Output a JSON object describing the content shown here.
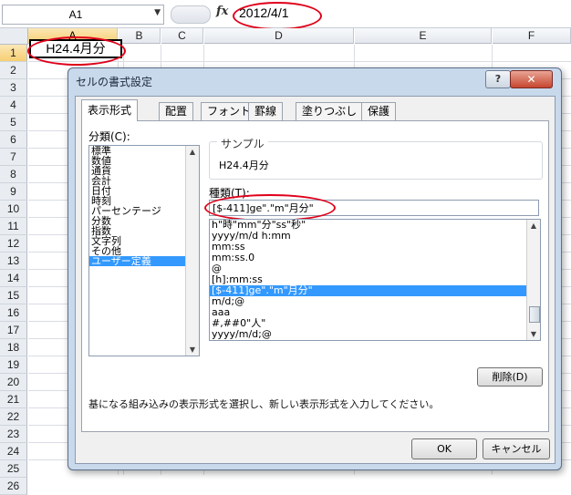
{
  "formula_bar": {
    "name_box": "A1",
    "fx_label": "fx",
    "formula": "2012/4/1"
  },
  "sheet": {
    "columns": [
      "A",
      "B",
      "C",
      "D",
      "E",
      "F"
    ],
    "rows": [
      "1",
      "2",
      "3",
      "4",
      "5",
      "6",
      "7",
      "8",
      "9",
      "10",
      "11",
      "12",
      "13",
      "14",
      "15",
      "16",
      "17",
      "18",
      "19",
      "20",
      "21",
      "22",
      "23",
      "24",
      "25",
      "26"
    ],
    "active_cell_value": "H24.4月分"
  },
  "dialog": {
    "title": "セルの書式設定",
    "help_label": "?",
    "close_label": "✕",
    "tabs": [
      {
        "label": "表示形式",
        "active": true
      },
      {
        "label": "配置"
      },
      {
        "label": "フォント"
      },
      {
        "label": "罫線"
      },
      {
        "label": "塗りつぶし"
      },
      {
        "label": "保護"
      }
    ],
    "category_label": "分類(C):",
    "categories": [
      "標準",
      "数値",
      "通貨",
      "会計",
      "日付",
      "時刻",
      "パーセンテージ",
      "分数",
      "指数",
      "文字列",
      "その他",
      "ユーザー定義"
    ],
    "selected_category": "ユーザー定義",
    "sample_label": "サンプル",
    "sample_value": "H24.4月分",
    "type_label": "種類(T):",
    "type_value": "[$-411]ge\".\"m\"月分\"",
    "format_list": [
      "h\"時\"mm\"分\"ss\"秒\"",
      "yyyy/m/d h:mm",
      "mm:ss",
      "mm:ss.0",
      "@",
      "[h]:mm:ss",
      "[$-411]ge\".\"m\"月分\"",
      "m/d;@",
      "aaa",
      "#,##0\"人\"",
      "yyyy/m/d;@"
    ],
    "selected_format_index": 6,
    "delete_label": "削除(D)",
    "description": "基になる組み込みの表示形式を選択し、新しい表示形式を入力してください。",
    "ok_label": "OK",
    "cancel_label": "キャンセル"
  },
  "colors": {
    "annotation_red": "#e0001a",
    "selection_blue": "#3399ff",
    "header_selected": "#f6cf73"
  }
}
